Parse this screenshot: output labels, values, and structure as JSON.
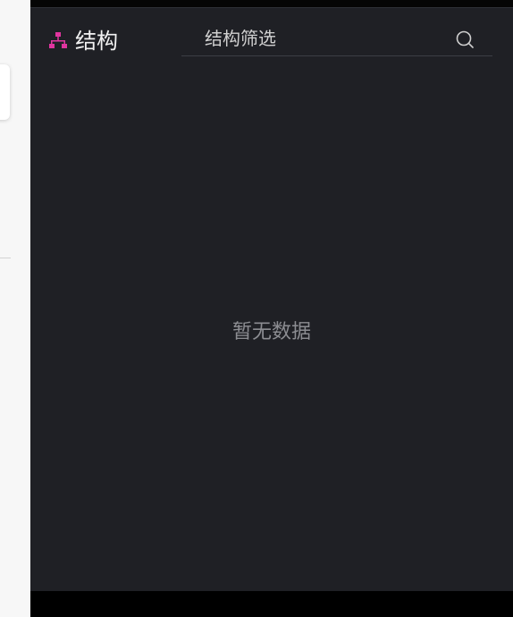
{
  "header": {
    "title": "结构",
    "icon": "sitemap-icon"
  },
  "search": {
    "placeholder": "结构筛选",
    "value": "",
    "icon": "search-icon"
  },
  "empty_state": {
    "text": "暂无数据"
  },
  "colors": {
    "panel_background": "#1f2025",
    "accent_icon": "#e0359f",
    "title_text": "#f2f2f2",
    "muted_text": "#8c8d92"
  }
}
